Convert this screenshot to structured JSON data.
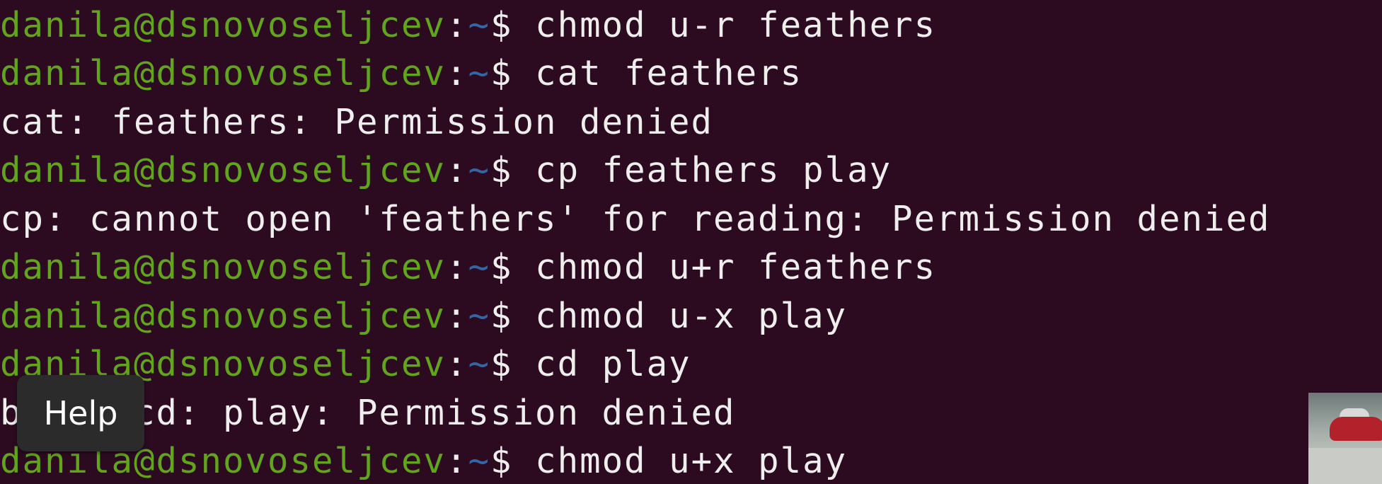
{
  "window": {
    "title": "danila@dsnovoseljcev: ~"
  },
  "terminal": {
    "lines": [
      {
        "type": "prompt",
        "user": "danila@dsnovoseljcev",
        "colon": ":",
        "path": "~",
        "dollar": "$ ",
        "command": "chmod u-r feathers"
      },
      {
        "type": "prompt",
        "user": "danila@dsnovoseljcev",
        "colon": ":",
        "path": "~",
        "dollar": "$ ",
        "command": "cat feathers"
      },
      {
        "type": "output",
        "text": "cat: feathers: Permission denied"
      },
      {
        "type": "prompt",
        "user": "danila@dsnovoseljcev",
        "colon": ":",
        "path": "~",
        "dollar": "$ ",
        "command": "cp feathers play"
      },
      {
        "type": "output",
        "text": "cp: cannot open 'feathers' for reading: Permission denied"
      },
      {
        "type": "prompt",
        "user": "danila@dsnovoseljcev",
        "colon": ":",
        "path": "~",
        "dollar": "$ ",
        "command": "chmod u+r feathers"
      },
      {
        "type": "prompt",
        "user": "danila@dsnovoseljcev",
        "colon": ":",
        "path": "~",
        "dollar": "$ ",
        "command": "chmod u-x play"
      },
      {
        "type": "prompt",
        "user": "danila@dsnovoseljcev",
        "colon": ":",
        "path": "~",
        "dollar": "$ ",
        "command": "cd play"
      },
      {
        "type": "output",
        "text": "bash: cd: play: Permission denied"
      },
      {
        "type": "prompt",
        "user": "danila@dsnovoseljcev",
        "colon": ":",
        "path": "~",
        "dollar": "$ ",
        "command": "chmod u+x play"
      }
    ]
  },
  "overlay": {
    "help_label": "Help"
  },
  "colors": {
    "background": "#2c0b21",
    "prompt_user": "#61a51c",
    "prompt_path": "#3465a4",
    "text": "#eeeeec"
  },
  "icons": {
    "video_thumbnail": "video-thumbnail-icon"
  }
}
